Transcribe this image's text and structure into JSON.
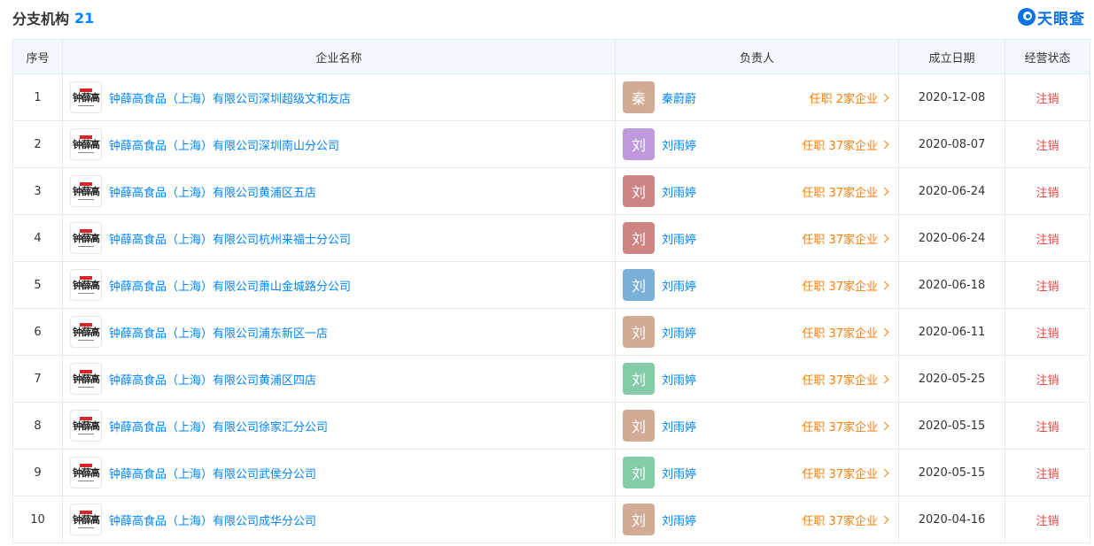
{
  "header": {
    "title": "分支机构",
    "count": "21"
  },
  "brand": {
    "name": "天眼查",
    "logo_icon": "tianyancha-logo-icon",
    "color": "#0a72e8"
  },
  "table": {
    "columns": [
      "序号",
      "企业名称",
      "负责人",
      "成立日期",
      "经营状态"
    ],
    "rows": [
      {
        "index": "1",
        "company": "钟薛高食品（上海）有限公司深圳超级文和友店",
        "avatar": "秦",
        "avatar_color": "#d2ab97",
        "person": "秦蔚蔚",
        "roles": "任职 2家企业",
        "date": "2020-12-08",
        "status": "注销"
      },
      {
        "index": "2",
        "company": "钟薛高食品（上海）有限公司深圳南山分公司",
        "avatar": "刘",
        "avatar_color": "#c099dc",
        "person": "刘雨婷",
        "roles": "任职 37家企业",
        "date": "2020-08-07",
        "status": "注销"
      },
      {
        "index": "3",
        "company": "钟薛高食品（上海）有限公司黄浦区五店",
        "avatar": "刘",
        "avatar_color": "#cf8484",
        "person": "刘雨婷",
        "roles": "任职 37家企业",
        "date": "2020-06-24",
        "status": "注销"
      },
      {
        "index": "4",
        "company": "钟薛高食品（上海）有限公司杭州来福士分公司",
        "avatar": "刘",
        "avatar_color": "#cf8484",
        "person": "刘雨婷",
        "roles": "任职 37家企业",
        "date": "2020-06-24",
        "status": "注销"
      },
      {
        "index": "5",
        "company": "钟薛高食品（上海）有限公司萧山金城路分公司",
        "avatar": "刘",
        "avatar_color": "#7ab0d8",
        "person": "刘雨婷",
        "roles": "任职 37家企业",
        "date": "2020-06-18",
        "status": "注销"
      },
      {
        "index": "6",
        "company": "钟薛高食品（上海）有限公司浦东新区一店",
        "avatar": "刘",
        "avatar_color": "#d2ab97",
        "person": "刘雨婷",
        "roles": "任职 37家企业",
        "date": "2020-06-11",
        "status": "注销"
      },
      {
        "index": "7",
        "company": "钟薛高食品（上海）有限公司黄浦区四店",
        "avatar": "刘",
        "avatar_color": "#84cba8",
        "person": "刘雨婷",
        "roles": "任职 37家企业",
        "date": "2020-05-25",
        "status": "注销"
      },
      {
        "index": "8",
        "company": "钟薛高食品（上海）有限公司徐家汇分公司",
        "avatar": "刘",
        "avatar_color": "#d2ab97",
        "person": "刘雨婷",
        "roles": "任职 37家企业",
        "date": "2020-05-15",
        "status": "注销"
      },
      {
        "index": "9",
        "company": "钟薛高食品（上海）有限公司武侯分公司",
        "avatar": "刘",
        "avatar_color": "#84cba8",
        "person": "刘雨婷",
        "roles": "任职 37家企业",
        "date": "2020-05-15",
        "status": "注销"
      },
      {
        "index": "10",
        "company": "钟薛高食品（上海）有限公司成华分公司",
        "avatar": "刘",
        "avatar_color": "#d2ab97",
        "person": "刘雨婷",
        "roles": "任职 37家企业",
        "date": "2020-04-16",
        "status": "注销"
      }
    ]
  },
  "company_logo": {
    "mark": "钟薛高",
    "icon": "company-logo-icon"
  },
  "colors": {
    "link": "#0084ff",
    "roles": "#ff7d0a",
    "status": "#f03f3f",
    "header_bg": "#f2f8fe"
  }
}
